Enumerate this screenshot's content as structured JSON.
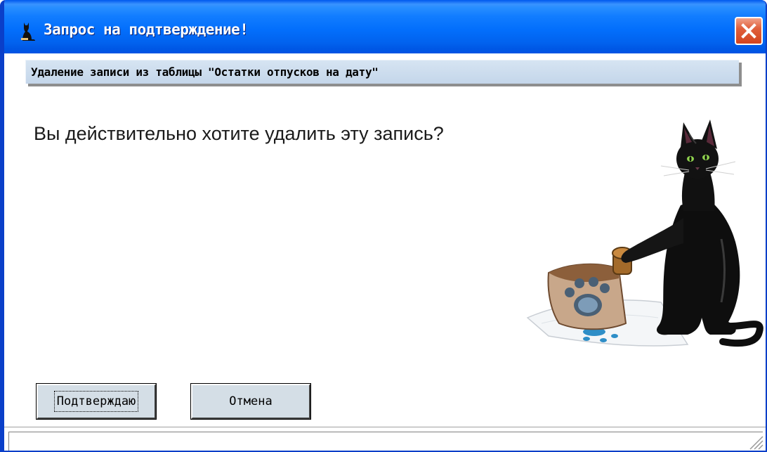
{
  "window": {
    "title": "Запрос на подтверждение!",
    "title_icon": "cat-silhouette-icon",
    "close_icon": "close-icon",
    "accent_color": "#0054E3"
  },
  "header": {
    "text": "Удаление записи из таблицы \"Остатки отпусков на дату\""
  },
  "message": {
    "text": "Вы действительно хотите удалить эту запись?"
  },
  "illustration": {
    "name": "black-cat-with-paw-stamp"
  },
  "buttons": {
    "confirm_label": "Подтверждаю",
    "cancel_label": "Отмена"
  }
}
